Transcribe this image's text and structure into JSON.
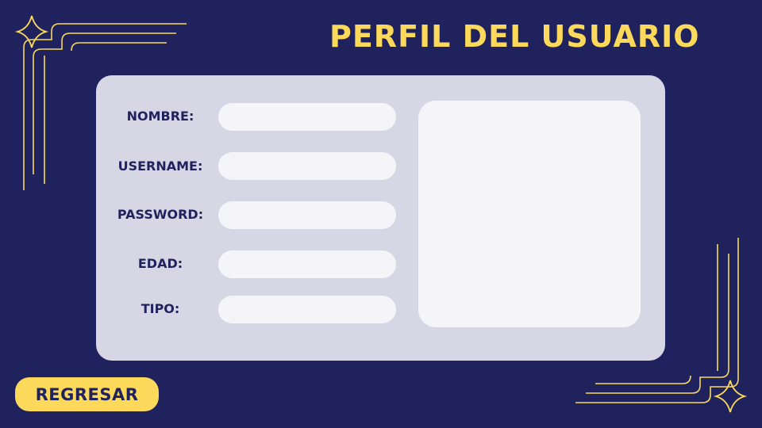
{
  "header": {
    "title": "PERFIL DEL USUARIO"
  },
  "form": {
    "fields": [
      {
        "label": "NOMBRE:",
        "value": ""
      },
      {
        "label": "USERNAME:",
        "value": ""
      },
      {
        "label": "PASSWORD:",
        "value": ""
      },
      {
        "label": "EDAD:",
        "value": ""
      },
      {
        "label": "TIPO:",
        "value": ""
      }
    ]
  },
  "actions": {
    "back_label": "REGRESAR"
  },
  "colors": {
    "background": "#1f225c",
    "accent": "#fcd95a",
    "card": "#d6d6e4",
    "field": "#f5f5f9"
  },
  "icons": [
    "sparkle-icon",
    "sparkle-icon"
  ]
}
